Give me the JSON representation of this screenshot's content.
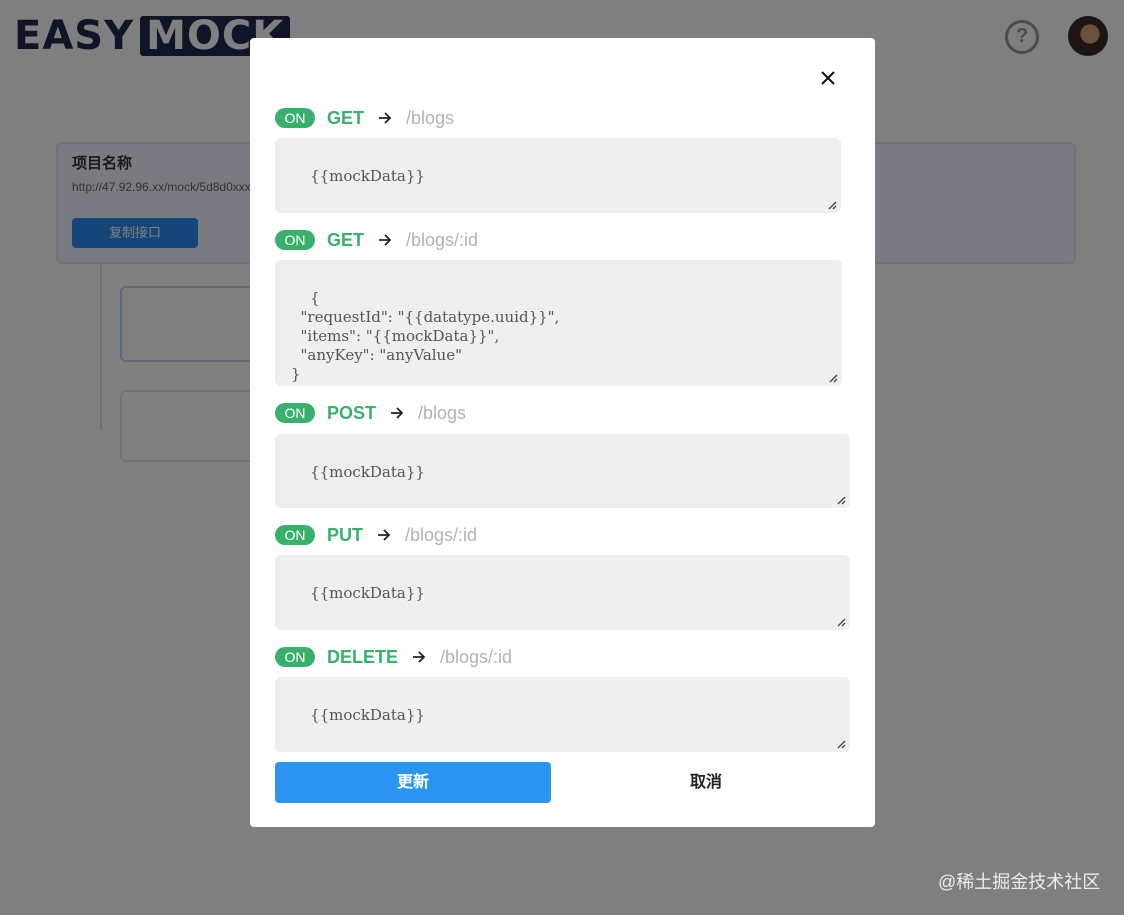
{
  "background": {
    "logo": {
      "part1": "EASY",
      "part2": "MOCK"
    },
    "project": {
      "title": "项目名称",
      "url": "http://47.92.96.xx/mock/5d8d0xxxx",
      "button": "复制接口"
    }
  },
  "modal": {
    "routes": [
      {
        "status": "ON",
        "method": "GET",
        "path": "/blogs",
        "body": "{{mockData}}"
      },
      {
        "status": "ON",
        "method": "GET",
        "path": "/blogs/:id",
        "body": "{\n  \"requestId\": \"{{datatype.uuid}}\",\n  \"items\": \"{{mockData}}\",\n  \"anyKey\": \"anyValue\"\n}"
      },
      {
        "status": "ON",
        "method": "POST",
        "path": "/blogs",
        "body": "{{mockData}}"
      },
      {
        "status": "ON",
        "method": "PUT",
        "path": "/blogs/:id",
        "body": "{{mockData}}"
      },
      {
        "status": "ON",
        "method": "DELETE",
        "path": "/blogs/:id",
        "body": "{{mockData}}"
      }
    ],
    "update_label": "更新",
    "cancel_label": "取消"
  },
  "watermark": "@稀土掘金技术社区",
  "colors": {
    "accent_green": "#3ab06d",
    "primary_blue": "#2c95f4"
  }
}
